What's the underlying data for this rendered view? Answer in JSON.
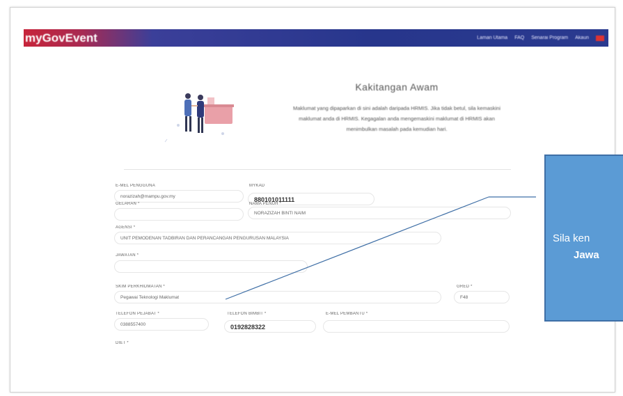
{
  "header": {
    "brand": "myGovEvent",
    "nav": [
      "Laman Utama",
      "FAQ",
      "Senarai Program",
      "Akaun"
    ]
  },
  "card": {
    "title": "Kakitangan Awam",
    "description": "Maklumat yang dipaparkan di sini adalah daripada HRMIS. Jika tidak betul, sila kemaskini maklumat anda di HRMIS. Kegagalan anda mengemaskini maklumat di HRMIS akan menimbulkan masalah pada kemudian hari."
  },
  "form": {
    "emel_pengguna": {
      "label": "E-MEL PENGGUNA",
      "value": "norazizah@mampu.gov.my"
    },
    "mykad": {
      "label": "MYKAD",
      "value": "880101011111"
    },
    "gelaran": {
      "label": "GELARAN *",
      "value": ""
    },
    "nama_penuh": {
      "label": "NAMA PENUH *",
      "value": "NORAZIZAH BINTI NAIM"
    },
    "agensi": {
      "label": "AGENSI *",
      "value": "UNIT PEMODENAN TADBIRAN DAN PERANCANGAN PENGURUSAN MALAYSIA"
    },
    "jawatan": {
      "label": "JAWATAN *",
      "value": ""
    },
    "skim": {
      "label": "SKIM PERKHIDMATAN *",
      "value": "Pegawai Teknologi Maklumat"
    },
    "gred": {
      "label": "GRED *",
      "value": "F48"
    },
    "tel_pejabat": {
      "label": "TELEFON PEJABAT *",
      "value": "0388557400"
    },
    "tel_bimbit": {
      "label": "TELEFON BIMBIT *",
      "value": "0192828322"
    },
    "emel_pembantu": {
      "label": "E-MEL PEMBANTU *",
      "value": ""
    },
    "diet": {
      "label": "DIET *"
    }
  },
  "callout": {
    "line1": "Sila ken",
    "line2": "Jawa"
  },
  "colors": {
    "callout_fill": "#5b9bd5",
    "header_red": "#c7243a",
    "header_blue": "#27368c"
  }
}
